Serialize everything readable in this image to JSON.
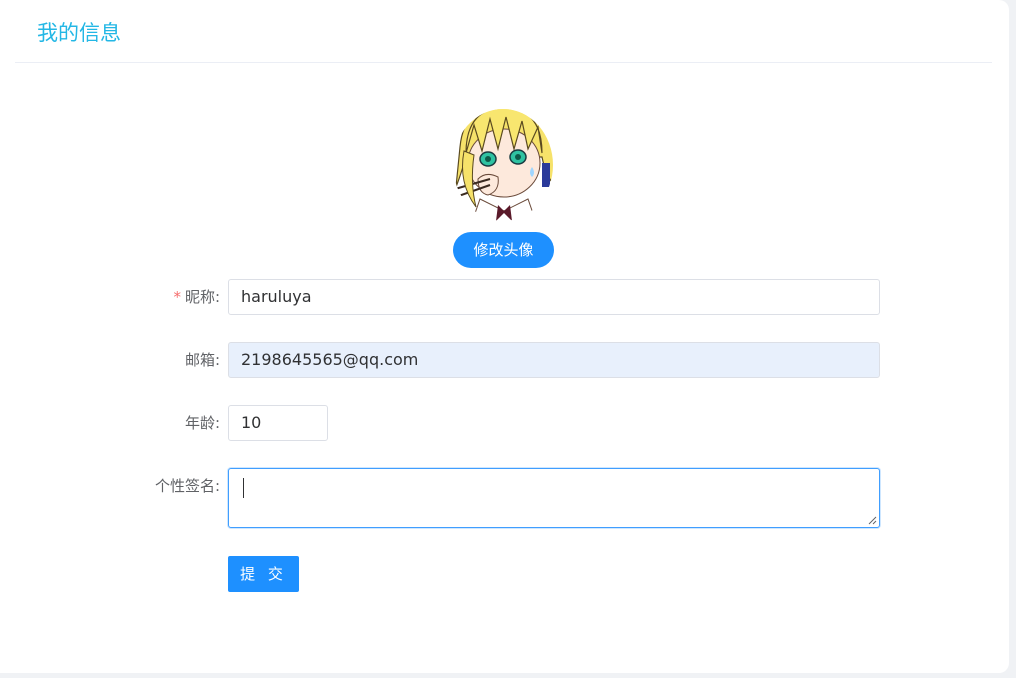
{
  "header": {
    "title": "我的信息"
  },
  "avatar": {
    "change_label": "修改头像"
  },
  "form": {
    "nickname": {
      "label": "昵称:",
      "required_mark": "*",
      "value": "haruluya"
    },
    "email": {
      "label": "邮箱:",
      "value": "2198645565@qq.com"
    },
    "age": {
      "label": "年龄:",
      "value": "10"
    },
    "signature": {
      "label": "个性签名:",
      "value": ""
    },
    "submit_label": "提 交"
  },
  "colors": {
    "accent": "#1e90ff",
    "title": "#23b7e5",
    "required": "#f56c6c"
  }
}
